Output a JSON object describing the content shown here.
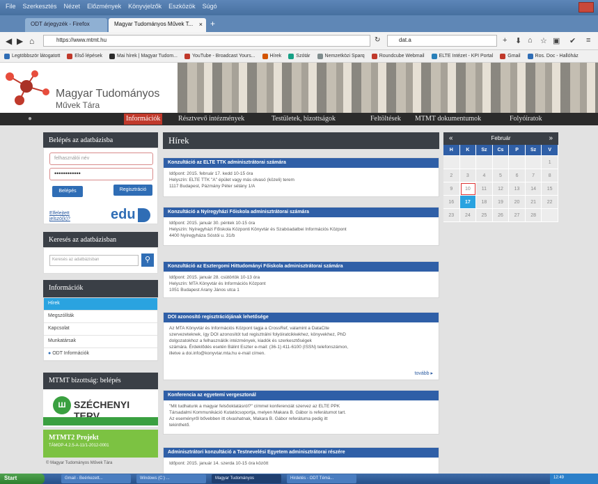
{
  "browser": {
    "menu": [
      "File",
      "Szerkesztés",
      "Nézet",
      "Előzmények",
      "Könyvjelzők",
      "Eszközök",
      "Súgó"
    ],
    "tabs": [
      {
        "label": "ODT árjegyzék - Firefox"
      },
      {
        "label": "Magyar Tudományos Művek T..."
      }
    ],
    "url": "https://www.mtmt.hu",
    "search_value": "dat.a",
    "bookmarks": [
      {
        "label": "Legtöbbször látogatott",
        "color": "#2f6db5"
      },
      {
        "label": "Első lépések",
        "color": "#c0392b"
      },
      {
        "label": "Mai hírek | Magyar Tudom...",
        "color": "#2b2b2b"
      },
      {
        "label": "YouTube - Broadcast Yours...",
        "color": "#c0392b"
      },
      {
        "label": "Hírek",
        "color": "#d35400"
      },
      {
        "label": "Szótár",
        "color": "#16a085"
      },
      {
        "label": "Nemzetközi Sparq",
        "color": "#7f8c8d"
      },
      {
        "label": "Roundcube Webmail",
        "color": "#c0392b"
      },
      {
        "label": "ELTE Intézet - KPI Portal",
        "color": "#2980b9"
      },
      {
        "label": "Gmail",
        "color": "#c0392b"
      },
      {
        "label": "Ros. Doc - Hallóház",
        "color": "#2f6db5"
      }
    ]
  },
  "site": {
    "logo_line1": "Magyar Tudományos",
    "logo_line2": "Művek Tára",
    "nav": [
      "Információk",
      "Résztvevő intézmények",
      "Testületek, bizottságok",
      "Feltöltések",
      "MTMT dokumentumok",
      "Folyóiratok"
    ],
    "login": {
      "title": "Belépés az adatbázisba",
      "user_placeholder": "felhasználói név",
      "password_dots": "••••••••••••",
      "login_btn": "Belépés",
      "register_btn": "Regisztráció",
      "forgot": "Elfelejtett jelszó(k)?",
      "edu": "edu"
    },
    "search": {
      "title": "Keresés az adatbázisban",
      "placeholder": "Keresés az adatbázisban"
    },
    "info": {
      "title": "Információk",
      "items": [
        "Hírek",
        "Megszólíták",
        "Kapcsolat",
        "Munkatársak",
        "ODT Információk"
      ]
    },
    "mtmt_bizottsag": "MTMT bizottság: belépés",
    "szechenyi": "SZÉCHENYI TERV",
    "project": {
      "title": "MTMT2 Projekt",
      "subtitle": "TÁMOP-4.2.5-A-11/1-2012-0001"
    },
    "footer_note": "© Magyar Tudományos Művek Tára",
    "news_title": "Hírek",
    "news": [
      {
        "title": "Konzultáció az ELTE TTK adminisztrátorai számára",
        "body": [
          "Időpont: 2015. február 17. kedd 10-15 óra",
          "Helyszín: ELTE TTK \"A\" épület vagy más olvasó (közeli) terem",
          "1117 Budapest, Pázmány Péter sétány 1/A"
        ]
      },
      {
        "title": "Konzultáció a Nyíregyházi Főiskola adminisztrátorai számára",
        "body": [
          "Időpont: 2015. január 30. péntek 10-15 óra",
          "Helyszín: Nyíregyházi Főiskola Központi Könyvtár és Szabóadatbei Információs Központ",
          "4400 Nyíregyháza Sóstói u. 31/b"
        ]
      },
      {
        "title": "Konzultáció az Esztergomi Hittudományi Főiskola adminisztrátorai számára",
        "body": [
          "Időpont: 2015. január 28. csütörtök 10-13 óra",
          "Helyszín: MTA Könyvtár és Információs Központ",
          "1051 Budapest Arany János utca 1"
        ]
      },
      {
        "title": "DOI azonosító regisztrációjának lehetősége",
        "body": [
          "Az MTA Könyvtár és Információs Központ tagja a CrossRef, valamint a DataCite",
          "szervezeteknek, így DOI azonosítót tud regisztrálni folyóiratcikkekhez, könyvekhez, PhD",
          "dolgozatokhoz a felhasználók intézmények, kiadók és szerkesztőségek",
          "számára. Érdeklődés esetén Bálint Eszter e-mail: (36-1) 411-6100 (ISSN) telefonszámon,",
          "illetve a doi.info@konyvtar.mta.hu e-mail címen."
        ],
        "more": "tovább ▸"
      },
      {
        "title": "Konferencia az egyetemi vergesztonál",
        "body": [
          "\"Mit tudhatunk a magyar felsőoktatásról?\" címmel konferenciát szervez az ELTE PPK",
          "Társadalmi Kommunikáció Kutatócsoportja, melyen Makara B. Gábor is referátumot tart.",
          "Az eseményről bővebben itt olvashatnak, Makara B. Gábor referátuma pedig itt",
          "tekinthető."
        ]
      },
      {
        "title": "Adminisztrátori konzultáció a Testnevelési Egyetem adminisztrátorai részére",
        "body": [
          "Időpont: 2015. január 14. szerda 10-15 óra között"
        ]
      }
    ],
    "calendar": {
      "month": "Február",
      "prev": "«",
      "next": "»",
      "dow": [
        "H",
        "K",
        "Sz",
        "Cs",
        "P",
        "Sz",
        "V"
      ],
      "weeks": [
        [
          "",
          "",
          "",
          "",
          "",
          "",
          "1"
        ],
        [
          "2",
          "3",
          "4",
          "5",
          "6",
          "7",
          "8"
        ],
        [
          "9",
          "10",
          "11",
          "12",
          "13",
          "14",
          "15"
        ],
        [
          "16",
          "17",
          "18",
          "19",
          "20",
          "21",
          "22"
        ],
        [
          "23",
          "24",
          "25",
          "26",
          "27",
          "28",
          ""
        ]
      ],
      "today": "17",
      "marked": "10"
    }
  },
  "taskbar": {
    "start": "Start",
    "items": [
      "Gmail - Beérkezett...",
      "Windows (C:) ...",
      "Magyar Tudományos",
      "Hirdetés - ODT Témá..."
    ],
    "tray": "12:49"
  }
}
